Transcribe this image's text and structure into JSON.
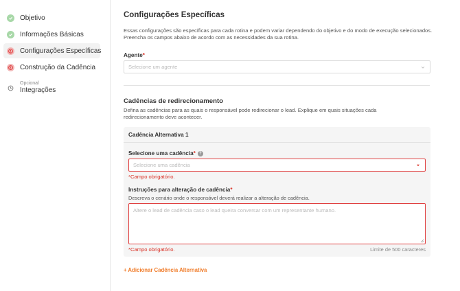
{
  "sidebar": {
    "steps": [
      {
        "label": "Objetivo",
        "status": "done"
      },
      {
        "label": "Informações Básicas",
        "status": "done"
      },
      {
        "label": "Configurações Específicas",
        "status": "error"
      },
      {
        "label": "Construção da Cadência",
        "status": "error"
      }
    ],
    "optional_step": {
      "sublabel": "Opcional",
      "label": "Integrações"
    }
  },
  "main": {
    "title": "Configurações Específicas",
    "description": "Essas configurações são específicas para cada rotina e podem variar dependendo do objetivo e do modo de execução selecionados. Preencha os campos abaixo de acordo com as necessidades da sua rotina.",
    "agent": {
      "label": "Agente",
      "required_mark": "*",
      "placeholder": "Selecione um agente"
    },
    "redirect": {
      "title": "Cadências de redirecionamento",
      "description": "Defina as cadências para as quais o responsável pode redirecionar o lead. Explique em quais situações cada redirecionamento deve acontecer.",
      "card": {
        "title": "Cadência Alternativa 1",
        "select_label": "Selecione uma cadência",
        "select_placeholder": "Selecione uma cadência",
        "select_error": "*Campo obrigatório.",
        "instructions_label": "Instruções para alteração de cadência",
        "instructions_hint": "Descreva o cenário onde o responsável deverá realizar a alteração de cadência.",
        "instructions_placeholder": "Altere o lead de cadência caso o lead queira conversar com um representante humano.",
        "instructions_error": "*Campo obrigatório.",
        "char_limit": "Limite de 500 caracteres"
      },
      "add_link": "+ Adicionar Cadência Alternativa"
    }
  },
  "colors": {
    "done": "#a8d8a8",
    "error": "#e04040",
    "accent": "#f07c2a"
  }
}
